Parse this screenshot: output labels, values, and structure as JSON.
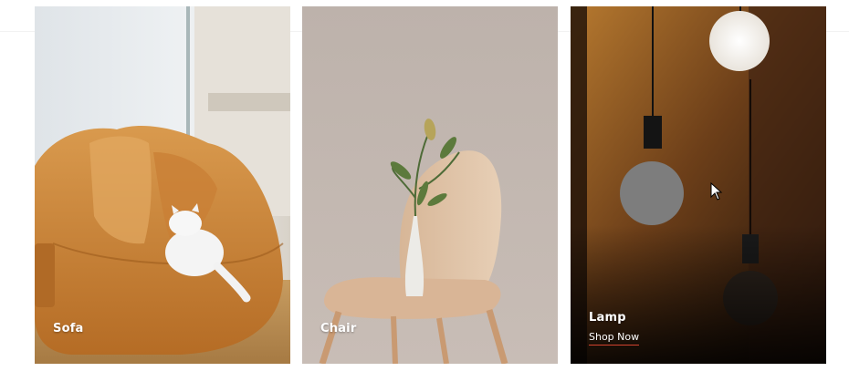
{
  "categories": [
    {
      "label": "Sofa",
      "name": "sofa"
    },
    {
      "label": "Chair",
      "name": "chair"
    },
    {
      "label": "Lamp",
      "name": "lamp",
      "cta": "Shop Now"
    }
  ],
  "colors": {
    "cta_underline": "#d2432f",
    "label_text": "#ffffff"
  }
}
